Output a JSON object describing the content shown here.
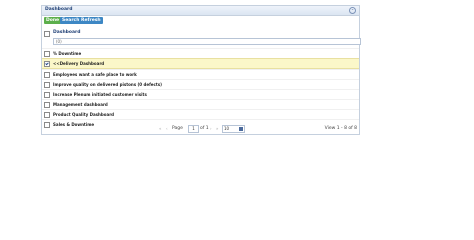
{
  "panel": {
    "title": "Dashboard",
    "collapse_icon": "collapse-icon"
  },
  "toolbar": {
    "done_label": "Done",
    "search_label": "Search",
    "refresh_label": "Refresh"
  },
  "header": {
    "column_label": "Dashboard",
    "filter_value": "(0)"
  },
  "rows": [
    {
      "label": "% Downtime",
      "checked": false
    },
    {
      "label": "<<Delivery Dashboard",
      "checked": true
    },
    {
      "label": "Employees want a safe place to work",
      "checked": false
    },
    {
      "label": "Improve quality on delivered pistons (0 defects)",
      "checked": false
    },
    {
      "label": "Increase Plenum initiated customer visits",
      "checked": false
    },
    {
      "label": "Management dashboard",
      "checked": false
    },
    {
      "label": "Product Quality Dashboard",
      "checked": false
    },
    {
      "label": "Sales & Downtime",
      "checked": false
    }
  ],
  "pager": {
    "first": "«",
    "prev": "‹",
    "page_label": "Page",
    "page_value": "1",
    "of_label": "of 1",
    "next": "›",
    "last": "»",
    "rows_per_page": "10",
    "view_text": "View 1 - 8 of 8"
  }
}
